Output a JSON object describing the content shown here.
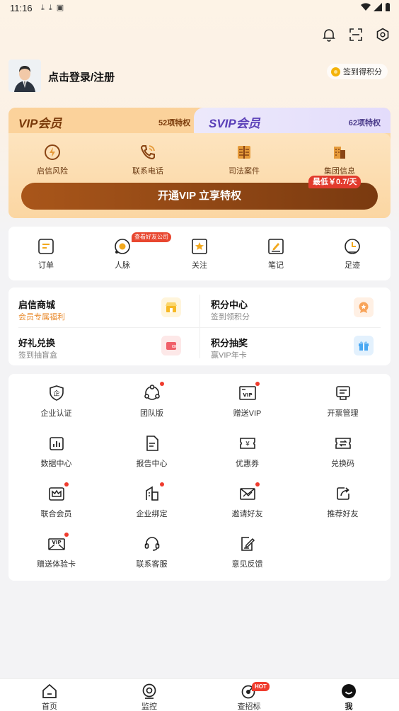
{
  "status_bar": {
    "time": "11:16"
  },
  "profile": {
    "login_text": "点击登录/注册",
    "signin_label": "签到得积分"
  },
  "vip": {
    "vip_title": "VIP会员",
    "vip_count": "52项特权",
    "svip_title": "SVIP会员",
    "svip_count": "62项特权",
    "perks": [
      {
        "label": "启信风险",
        "icon": "shield-bolt-icon"
      },
      {
        "label": "联系电话",
        "icon": "phone-icon"
      },
      {
        "label": "司法案件",
        "icon": "gavel-book-icon"
      },
      {
        "label": "集团信息",
        "icon": "building-icon"
      }
    ],
    "price_badge": "最低￥0.7/天",
    "button_label": "开通VIP 立享特权",
    "accent_color": "#8a4514"
  },
  "quick": {
    "tag": "查看好友公司",
    "items": [
      {
        "label": "订单",
        "icon": "order-icon"
      },
      {
        "label": "人脉",
        "icon": "network-icon"
      },
      {
        "label": "关注",
        "icon": "star-icon"
      },
      {
        "label": "笔记",
        "icon": "note-icon"
      },
      {
        "label": "足迹",
        "icon": "clock-icon"
      }
    ]
  },
  "mall": {
    "items": [
      {
        "title": "启信商城",
        "subtitle": "会员专属福利",
        "subtitle_color": "#e98a2c",
        "icon": "shop-icon"
      },
      {
        "title": "积分中心",
        "subtitle": "签到领积分",
        "subtitle_color": "#888888",
        "icon": "medal-icon"
      },
      {
        "title": "好礼兑换",
        "subtitle": "签到抽盲盒",
        "subtitle_color": "#888888",
        "icon": "wallet-icon"
      },
      {
        "title": "积分抽奖",
        "subtitle": "赢VIP年卡",
        "subtitle_color": "#888888",
        "icon": "gift-icon"
      }
    ]
  },
  "grid": {
    "items": [
      {
        "label": "企业认证",
        "icon": "certify-icon",
        "dot": false
      },
      {
        "label": "团队版",
        "icon": "team-icon",
        "dot": true
      },
      {
        "label": "赠送VIP",
        "icon": "vip-ticket-icon",
        "dot": true
      },
      {
        "label": "开票管理",
        "icon": "invoice-icon",
        "dot": false
      },
      {
        "label": "数据中心",
        "icon": "chart-icon",
        "dot": false
      },
      {
        "label": "报告中心",
        "icon": "report-icon",
        "dot": false
      },
      {
        "label": "优惠券",
        "icon": "coupon-icon",
        "dot": false
      },
      {
        "label": "兑换码",
        "icon": "exchange-icon",
        "dot": false
      },
      {
        "label": "联合会员",
        "icon": "crown-icon",
        "dot": true
      },
      {
        "label": "企业绑定",
        "icon": "company-bind-icon",
        "dot": true
      },
      {
        "label": "邀请好友",
        "icon": "invite-mail-icon",
        "dot": true
      },
      {
        "label": "推荐好友",
        "icon": "share-icon",
        "dot": false
      },
      {
        "label": "赠送体验卡",
        "icon": "vip-mail-icon",
        "dot": true
      },
      {
        "label": "联系客服",
        "icon": "headset-icon",
        "dot": false
      },
      {
        "label": "意见反馈",
        "icon": "feedback-icon",
        "dot": false
      }
    ]
  },
  "tabbar": {
    "hot_badge": "HOT",
    "items": [
      {
        "label": "首页",
        "icon": "home-icon",
        "active": false
      },
      {
        "label": "监控",
        "icon": "monitor-icon",
        "active": false
      },
      {
        "label": "查招标",
        "icon": "bid-icon",
        "active": false
      },
      {
        "label": "我",
        "icon": "me-icon",
        "active": true
      }
    ]
  }
}
